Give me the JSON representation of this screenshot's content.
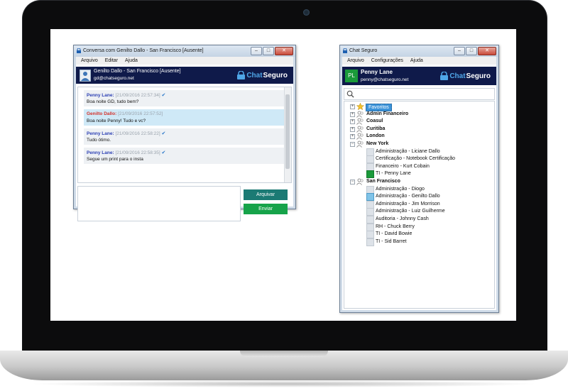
{
  "chat_window": {
    "title": "Conversa com Genilto Dallo - San Francisco [Ausente]",
    "menu": [
      "Arquivo",
      "Editar",
      "Ajuda"
    ],
    "contact": {
      "name_line": "Genilto Dallo - San Francisco [Ausente]",
      "email": "gd@chatseguro.net"
    },
    "messages": [
      {
        "sender": "Penny Lane:",
        "time": "[21/09/2016 22:57:34]",
        "text": "Boa noite GD, tudo bem?",
        "sender_color": "#2b3fb3",
        "checked": true,
        "highlight": false
      },
      {
        "sender": "Genilto Dallo:",
        "time": "[21/09/2016 22:57:52]",
        "text": "Boa noite Penny! Tudo e vc?",
        "sender_color": "#d3312b",
        "checked": false,
        "highlight": true
      },
      {
        "sender": "Penny Lane:",
        "time": "[21/09/2016 22:58:22]",
        "text": "Tudo ótimo.",
        "sender_color": "#2b3fb3",
        "checked": true,
        "highlight": false
      },
      {
        "sender": "Penny Lane:",
        "time": "[21/09/2016 22:58:35]",
        "text": "Segue um print para o insta",
        "sender_color": "#2b3fb3",
        "checked": true,
        "highlight": false
      }
    ],
    "compose_value": "",
    "buttons": {
      "archive": "Arquivar",
      "send": "Enviar"
    }
  },
  "brand": {
    "chat": "Chat",
    "seguro": "Seguro"
  },
  "main_window": {
    "title": "Chat Seguro",
    "menu": [
      "Arquivo",
      "Configurações",
      "Ajuda"
    ],
    "user": {
      "initials": "PL",
      "name": "Penny Lane",
      "email": "penny@chatseguro.net"
    },
    "search_value": "",
    "tree": [
      {
        "label": "Favoritos",
        "kind": "favorites",
        "expander": "+"
      },
      {
        "label": "Admin Financeiro",
        "kind": "group",
        "expander": "+"
      },
      {
        "label": "Coasul",
        "kind": "group",
        "expander": "+"
      },
      {
        "label": "Curitiba",
        "kind": "group",
        "expander": "+"
      },
      {
        "label": "London",
        "kind": "group",
        "expander": "+"
      },
      {
        "label": "New York",
        "kind": "group",
        "expander": "−"
      },
      {
        "label": "Administração - Liciane Dallo",
        "kind": "contact",
        "status": "offline"
      },
      {
        "label": "Certificação - Notebook Certificação",
        "kind": "contact",
        "status": "offline"
      },
      {
        "label": "Financeiro - Kurt Cobain",
        "kind": "contact",
        "status": "offline"
      },
      {
        "label": "TI - Penny Lane",
        "kind": "contact",
        "status": "online"
      },
      {
        "label": "San Francisco",
        "kind": "group",
        "expander": "−"
      },
      {
        "label": "Administração - Diogo",
        "kind": "contact",
        "status": "offline"
      },
      {
        "label": "Administração - Genilto Dallo",
        "kind": "contact",
        "status": "away"
      },
      {
        "label": "Administração - Jim Morrison",
        "kind": "contact",
        "status": "offline"
      },
      {
        "label": "Administração - Luiz Guilherme",
        "kind": "contact",
        "status": "offline"
      },
      {
        "label": "Auditoria - Johnny Cash",
        "kind": "contact",
        "status": "offline"
      },
      {
        "label": "RH - Chuck Berry",
        "kind": "contact",
        "status": "offline"
      },
      {
        "label": "TI - David Bowie",
        "kind": "contact",
        "status": "offline"
      },
      {
        "label": "TI - Sid Barret",
        "kind": "contact",
        "status": "offline"
      }
    ]
  },
  "colors": {
    "banner": "#0f1a4a",
    "brand_blue": "#4fa6e8",
    "archive_button": "#1b7a74",
    "send_button": "#16a34a",
    "user_avatar": "#1a9a3a",
    "favorites_highlight": "#3b93d9",
    "message_highlight": "#cfe9f7"
  },
  "icons": {
    "lock": "lock-icon",
    "search": "search-icon",
    "star": "star-icon",
    "group": "group-icon",
    "person": "person-icon",
    "check": "check-icon"
  }
}
